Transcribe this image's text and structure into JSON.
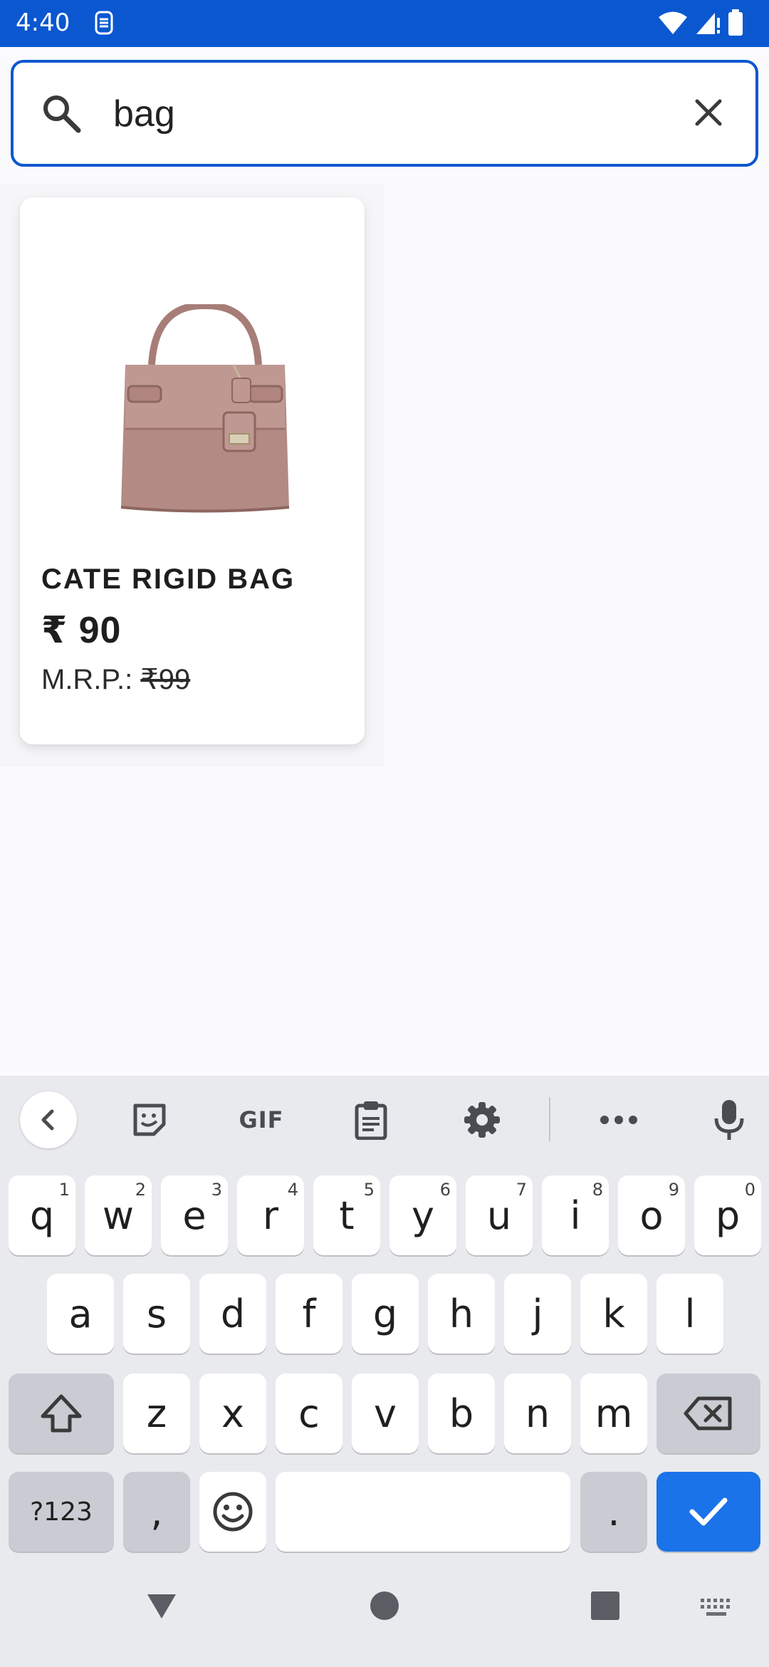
{
  "status_bar": {
    "time": "4:40"
  },
  "search": {
    "query": "bag",
    "placeholder": ""
  },
  "product": {
    "name": "CATE RIGID BAG",
    "price": "₹ 90",
    "mrp_label": "M.R.P.: ",
    "mrp_value": "₹99"
  },
  "keyboard": {
    "toolbar": {
      "gif_label": "GIF"
    },
    "row1": [
      {
        "key": "q",
        "hint": "1"
      },
      {
        "key": "w",
        "hint": "2"
      },
      {
        "key": "e",
        "hint": "3"
      },
      {
        "key": "r",
        "hint": "4"
      },
      {
        "key": "t",
        "hint": "5"
      },
      {
        "key": "y",
        "hint": "6"
      },
      {
        "key": "u",
        "hint": "7"
      },
      {
        "key": "i",
        "hint": "8"
      },
      {
        "key": "o",
        "hint": "9"
      },
      {
        "key": "p",
        "hint": "0"
      }
    ],
    "row2": [
      "a",
      "s",
      "d",
      "f",
      "g",
      "h",
      "j",
      "k",
      "l"
    ],
    "row3": [
      "z",
      "x",
      "c",
      "v",
      "b",
      "n",
      "m"
    ],
    "row4": {
      "symbols": "?123",
      "comma": ",",
      "period": "."
    }
  },
  "colors": {
    "accent": "#0b57d0",
    "action_key": "#1a73e8",
    "bag": "#b38a84"
  },
  "icons": {
    "search": "search-icon",
    "clear": "close-icon",
    "back": "chevron-left-icon",
    "sticker": "sticker-icon",
    "clipboard": "clipboard-icon",
    "settings": "gear-icon",
    "more": "more-horiz-icon",
    "mic": "mic-icon",
    "shift": "shift-icon",
    "backspace": "backspace-icon",
    "emoji": "emoji-icon",
    "enter": "check-icon"
  }
}
